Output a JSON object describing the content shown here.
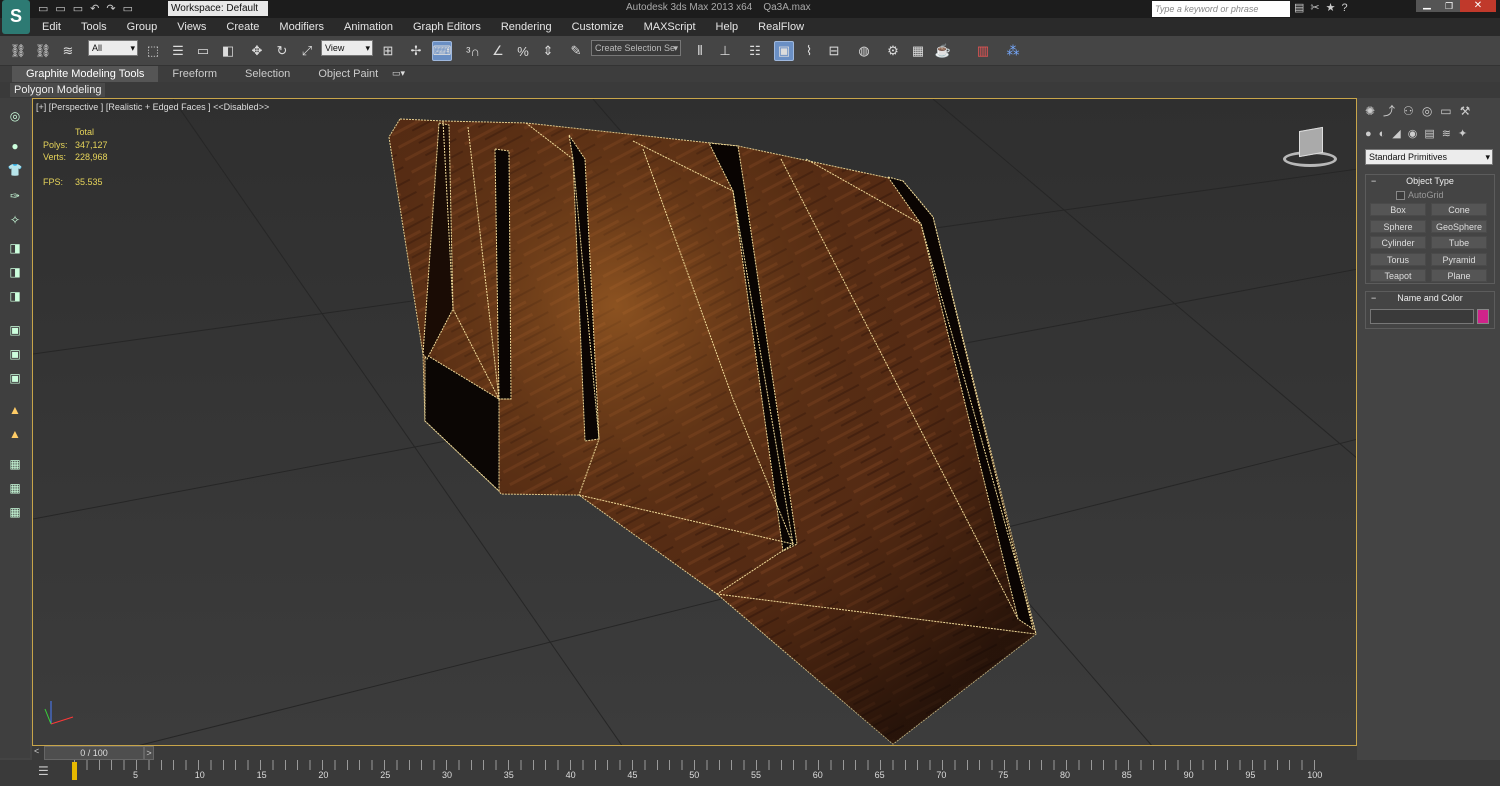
{
  "title_bar": {
    "workspace": "Workspace: Default",
    "app_title": "Autodesk 3ds Max  2013 x64",
    "file_name": "Qa3A.max",
    "search_placeholder": "Type a keyword or phrase"
  },
  "menu": [
    "Edit",
    "Tools",
    "Group",
    "Views",
    "Create",
    "Modifiers",
    "Animation",
    "Graph Editors",
    "Rendering",
    "Customize",
    "MAXScript",
    "Help",
    "RealFlow"
  ],
  "toolbar": {
    "filter_value": "All",
    "coord_value": "View",
    "selection_set_placeholder": "Create Selection Se"
  },
  "ribbon": {
    "tabs": [
      "Graphite Modeling Tools",
      "Freeform",
      "Selection",
      "Object Paint"
    ],
    "active_tab": "Graphite Modeling Tools",
    "panel_label": "Polygon Modeling"
  },
  "viewport": {
    "label_plus": "[+]",
    "label_view": "[Perspective ]",
    "label_shading": "[Realistic + Edged Faces ]",
    "label_disabled": "<<Disabled>>",
    "stats": {
      "total_label": "Total",
      "polys_label": "Polys:",
      "polys_value": "347,127",
      "verts_label": "Verts:",
      "verts_value": "228,968",
      "fps_label": "FPS:",
      "fps_value": "35.535"
    },
    "selection_color": "#f2dc9a"
  },
  "command_panel": {
    "category": "Standard Primitives",
    "object_type_header": "Object Type",
    "autogrid_label": "AutoGrid",
    "buttons": [
      "Box",
      "Cone",
      "Sphere",
      "GeoSphere",
      "Cylinder",
      "Tube",
      "Torus",
      "Pyramid",
      "Teapot",
      "Plane"
    ],
    "name_color_header": "Name and Color",
    "name_value": "",
    "object_color": "#d0238a"
  },
  "timeline": {
    "frame_label": "0 / 100",
    "ticks": [
      "5",
      "10",
      "15",
      "20",
      "25",
      "30",
      "35",
      "40",
      "45",
      "50",
      "55",
      "60",
      "65",
      "70",
      "75",
      "80",
      "85",
      "90",
      "95",
      "100"
    ]
  }
}
